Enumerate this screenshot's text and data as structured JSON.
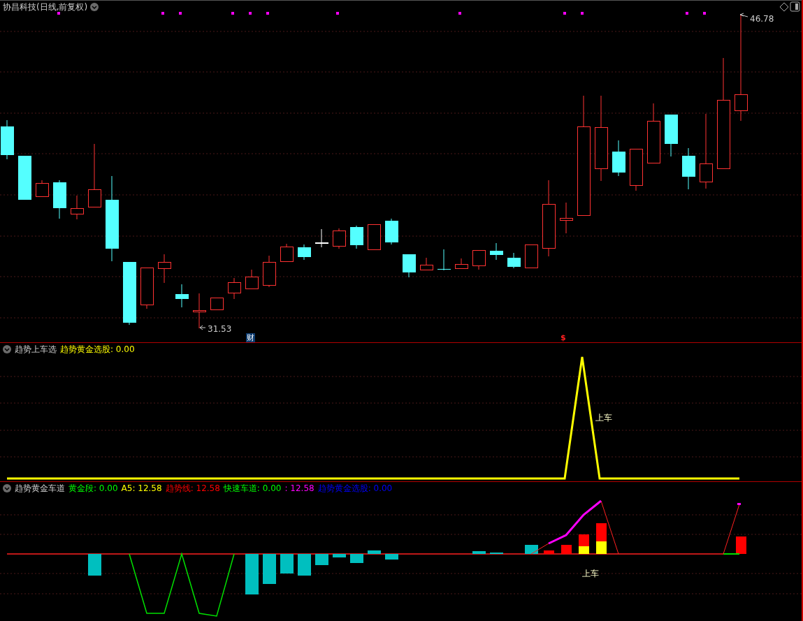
{
  "title": "协昌科技(日线,前复权)",
  "price_chart": {
    "high_label": "46.78",
    "low_label": "31.53",
    "event_markers": [
      {
        "kind": "finance",
        "text": "财"
      },
      {
        "kind": "dollar",
        "text": "$"
      }
    ]
  },
  "panels": [
    {
      "name": "趋势上车选",
      "values": [
        {
          "text": "趋势黄金选股: 0.00",
          "color": "#ffff00"
        }
      ],
      "signal_label": "上车"
    },
    {
      "name": "趋势黄金车道",
      "values": [
        {
          "text": "黄金段: 0.00",
          "color": "#00ff00"
        },
        {
          "text": "A5: 12.58",
          "color": "#ffff00"
        },
        {
          "text": "趋势线: 12.58",
          "color": "#ff0000"
        },
        {
          "text": "快速车道: 0.00",
          "color": "#00ff00"
        },
        {
          "text": ": 12.58",
          "color": "#ff00ff"
        },
        {
          "text": "趋势黄金选股: 0.00",
          "color": "#0000ff"
        }
      ],
      "signal_label": "上车"
    }
  ]
}
